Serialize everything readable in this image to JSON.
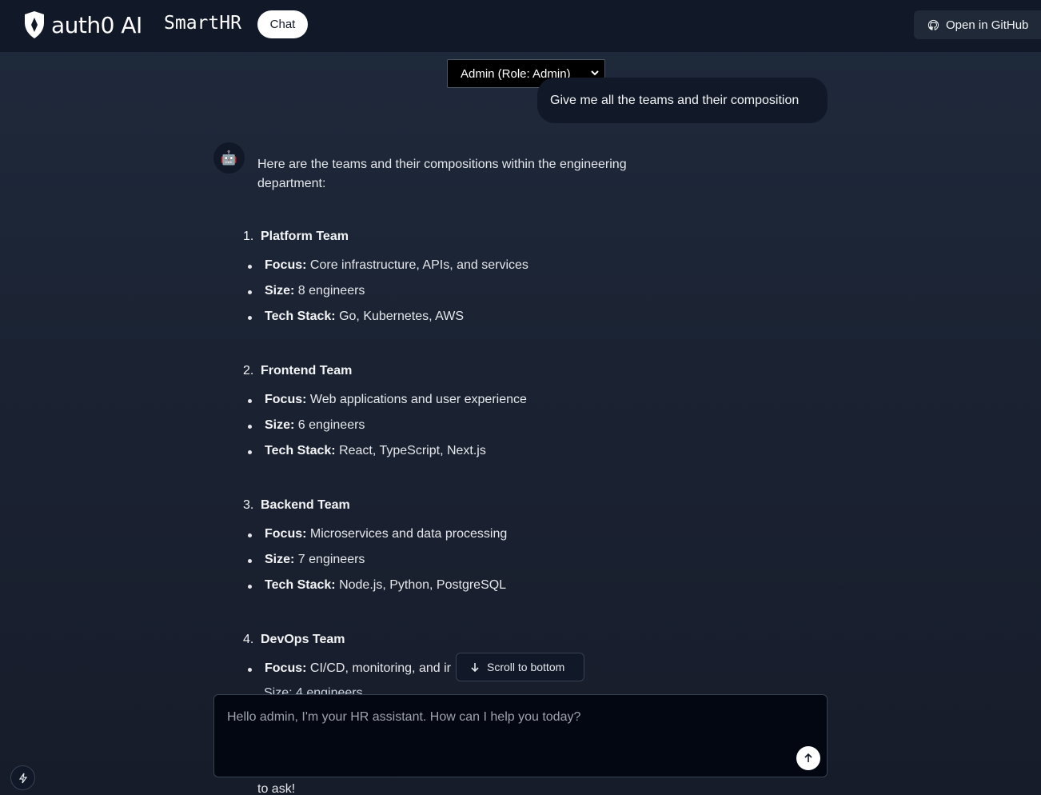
{
  "header": {
    "logo_text": "auth0 AI",
    "app_name": "SmartHR",
    "chat_pill": "Chat",
    "github_label": "Open in GitHub"
  },
  "role_select": {
    "value": "Admin (Role: Admin)"
  },
  "user_message": "Give me all the teams and their composition",
  "assistant": {
    "avatar": "🤖",
    "intro_line1": "Here are the teams and their compositions within the engineering",
    "intro_line2": "department:",
    "teams": [
      {
        "num": "1.",
        "name": "Platform Team",
        "focus_label": "Focus:",
        "focus": "Core infrastructure, APIs, and services",
        "size_label": "Size:",
        "size": "8 engineers",
        "stack_label": "Tech Stack:",
        "stack": "Go, Kubernetes, AWS"
      },
      {
        "num": "2.",
        "name": "Frontend Team",
        "focus_label": "Focus:",
        "focus": "Web applications and user experience",
        "size_label": "Size:",
        "size": "6 engineers",
        "stack_label": "Tech Stack:",
        "stack": "React, TypeScript, Next.js"
      },
      {
        "num": "3.",
        "name": "Backend Team",
        "focus_label": "Focus:",
        "focus": "Microservices and data processing",
        "size_label": "Size:",
        "size": "7 engineers",
        "stack_label": "Tech Stack:",
        "stack": "Node.js, Python, PostgreSQL"
      },
      {
        "num": "4.",
        "name": "DevOps Team",
        "focus_label": "Focus:",
        "focus": "CI/CD, monitoring, and ir",
        "size_partial": "Size: 4 engineers"
      }
    ],
    "tail_text": "to ask!"
  },
  "scroll_button": "Scroll to bottom",
  "composer": {
    "placeholder": "Hello admin, I'm your HR assistant. How can I help you today?"
  },
  "icons": [
    "auth0-shield-icon",
    "github-icon",
    "chevron-down-icon",
    "arrow-down-icon",
    "arrow-up-icon",
    "bolt-icon"
  ]
}
